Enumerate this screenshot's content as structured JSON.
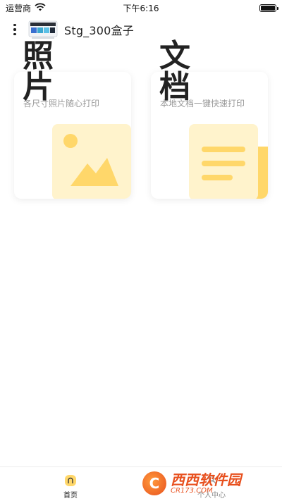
{
  "status_bar": {
    "carrier": "运营商",
    "time": "下午6:16"
  },
  "header": {
    "menu_icon": "more-vertical-icon",
    "device_name": "Stg_300盒子"
  },
  "cards": {
    "photo": {
      "title": "照片",
      "subtitle": "各尺寸照片随心打印",
      "icon": "image-icon"
    },
    "document": {
      "title": "文档",
      "subtitle": "本地文档一键快速打印",
      "icon": "document-icon"
    }
  },
  "tab_bar": {
    "home": {
      "label": "首页",
      "icon": "home-icon"
    },
    "profile": {
      "label": "个人中心",
      "icon": "user-icon"
    }
  },
  "watermark": {
    "main": "西西软件园",
    "sub": "CR173.COM"
  },
  "colors": {
    "accent_yellow": "#ffd76a",
    "light_yellow": "#fff3cc",
    "subtitle_gray": "#9a9a9a"
  }
}
